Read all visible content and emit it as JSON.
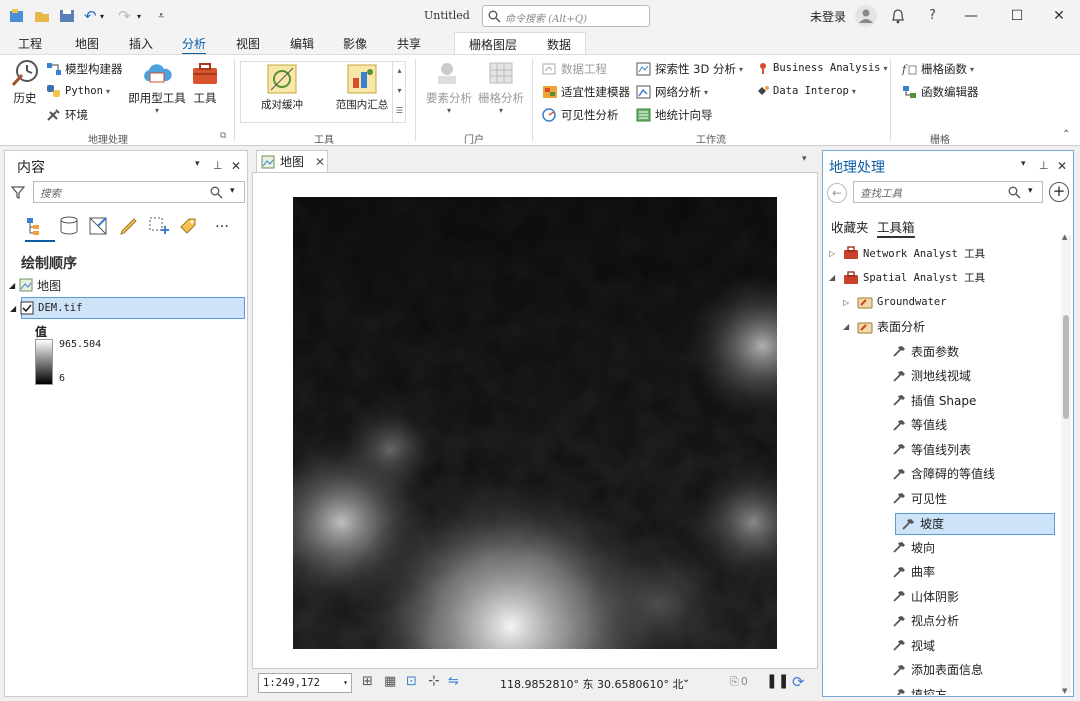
{
  "title_bar": {
    "doc_title": "Untitled",
    "command_search_placeholder": "命令搜索 (Alt+Q)",
    "signin_label": "未登录"
  },
  "ribbon_tabs": [
    "工程",
    "地图",
    "插入",
    "分析",
    "视图",
    "编辑",
    "影像",
    "共享"
  ],
  "active_tab": "分析",
  "context_tabs": [
    "栅格图层",
    "数据"
  ],
  "ribbon": {
    "geoprocessing": {
      "label": "地理处理",
      "history": "历史",
      "model_builder": "模型构建器",
      "python": "Python",
      "environments": "环境",
      "ready_tools": "即用型工具",
      "tools": "工具"
    },
    "tools_group": {
      "label": "工具",
      "gallery": [
        "成对缓冲",
        "范围内汇总"
      ]
    },
    "portal": {
      "label": "门户",
      "feature_analysis": "要素分析",
      "raster_analysis": "栅格分析"
    },
    "workflows": {
      "label": "工作流",
      "data_engineering": "数据工程",
      "suitability_modeler": "适宜性建模器",
      "visibility_analysis": "可见性分析",
      "exploratory_3d": "探索性 3D 分析",
      "network_analysis": "网络分析",
      "geostatistical_wizard": "地统计向导",
      "business_analysis": "Business Analysis",
      "data_interop": "Data Interop"
    },
    "raster": {
      "label": "栅格",
      "raster_functions": "栅格函数",
      "function_editor": "函数编辑器"
    }
  },
  "contents_pane": {
    "title": "内容",
    "search_placeholder": "搜索",
    "drawing_order": "绘制顺序",
    "map_name": "地图",
    "layer_name": "DEM.tif",
    "legend_title": "值",
    "legend_max": "965.504",
    "legend_min": "6"
  },
  "map_view": {
    "tab_label": "地图",
    "scale": "1:249,172",
    "coords": "118.9852810° 东  30.6580610° 北",
    "selection_count": "0"
  },
  "geoprocessing_pane": {
    "title": "地理处理",
    "search_placeholder": "查找工具",
    "tabs": [
      "收藏夹",
      "工具箱"
    ],
    "active_tab": "工具箱",
    "tree": [
      {
        "label": "Network Analyst 工具",
        "kind": "toolbox",
        "level": 0,
        "expanded": false
      },
      {
        "label": "Spatial Analyst 工具",
        "kind": "toolbox",
        "level": 0,
        "expanded": true
      },
      {
        "label": "Groundwater",
        "kind": "toolset",
        "level": 1,
        "expanded": false
      },
      {
        "label": "表面分析",
        "kind": "toolset",
        "level": 1,
        "expanded": true
      },
      {
        "label": "表面参数",
        "kind": "tool",
        "level": 2
      },
      {
        "label": "测地线视域",
        "kind": "tool",
        "level": 2
      },
      {
        "label": "插值 Shape",
        "kind": "tool",
        "level": 2
      },
      {
        "label": "等值线",
        "kind": "tool",
        "level": 2
      },
      {
        "label": "等值线列表",
        "kind": "tool",
        "level": 2
      },
      {
        "label": "含障碍的等值线",
        "kind": "tool",
        "level": 2
      },
      {
        "label": "可见性",
        "kind": "tool",
        "level": 2
      },
      {
        "label": "坡度",
        "kind": "tool",
        "level": 2,
        "selected": true
      },
      {
        "label": "坡向",
        "kind": "tool",
        "level": 2
      },
      {
        "label": "曲率",
        "kind": "tool",
        "level": 2
      },
      {
        "label": "山体阴影",
        "kind": "tool",
        "level": 2
      },
      {
        "label": "视点分析",
        "kind": "tool",
        "level": 2
      },
      {
        "label": "视域",
        "kind": "tool",
        "level": 2
      },
      {
        "label": "添加表面信息",
        "kind": "tool",
        "level": 2
      },
      {
        "label": "填挖方",
        "kind": "tool",
        "level": 2
      }
    ]
  },
  "colors": {
    "accent": "#0a5ea8",
    "selection_fill": "#cde3f7",
    "selection_border": "#5a9bd5",
    "toolbox_red": "#c8412b"
  }
}
